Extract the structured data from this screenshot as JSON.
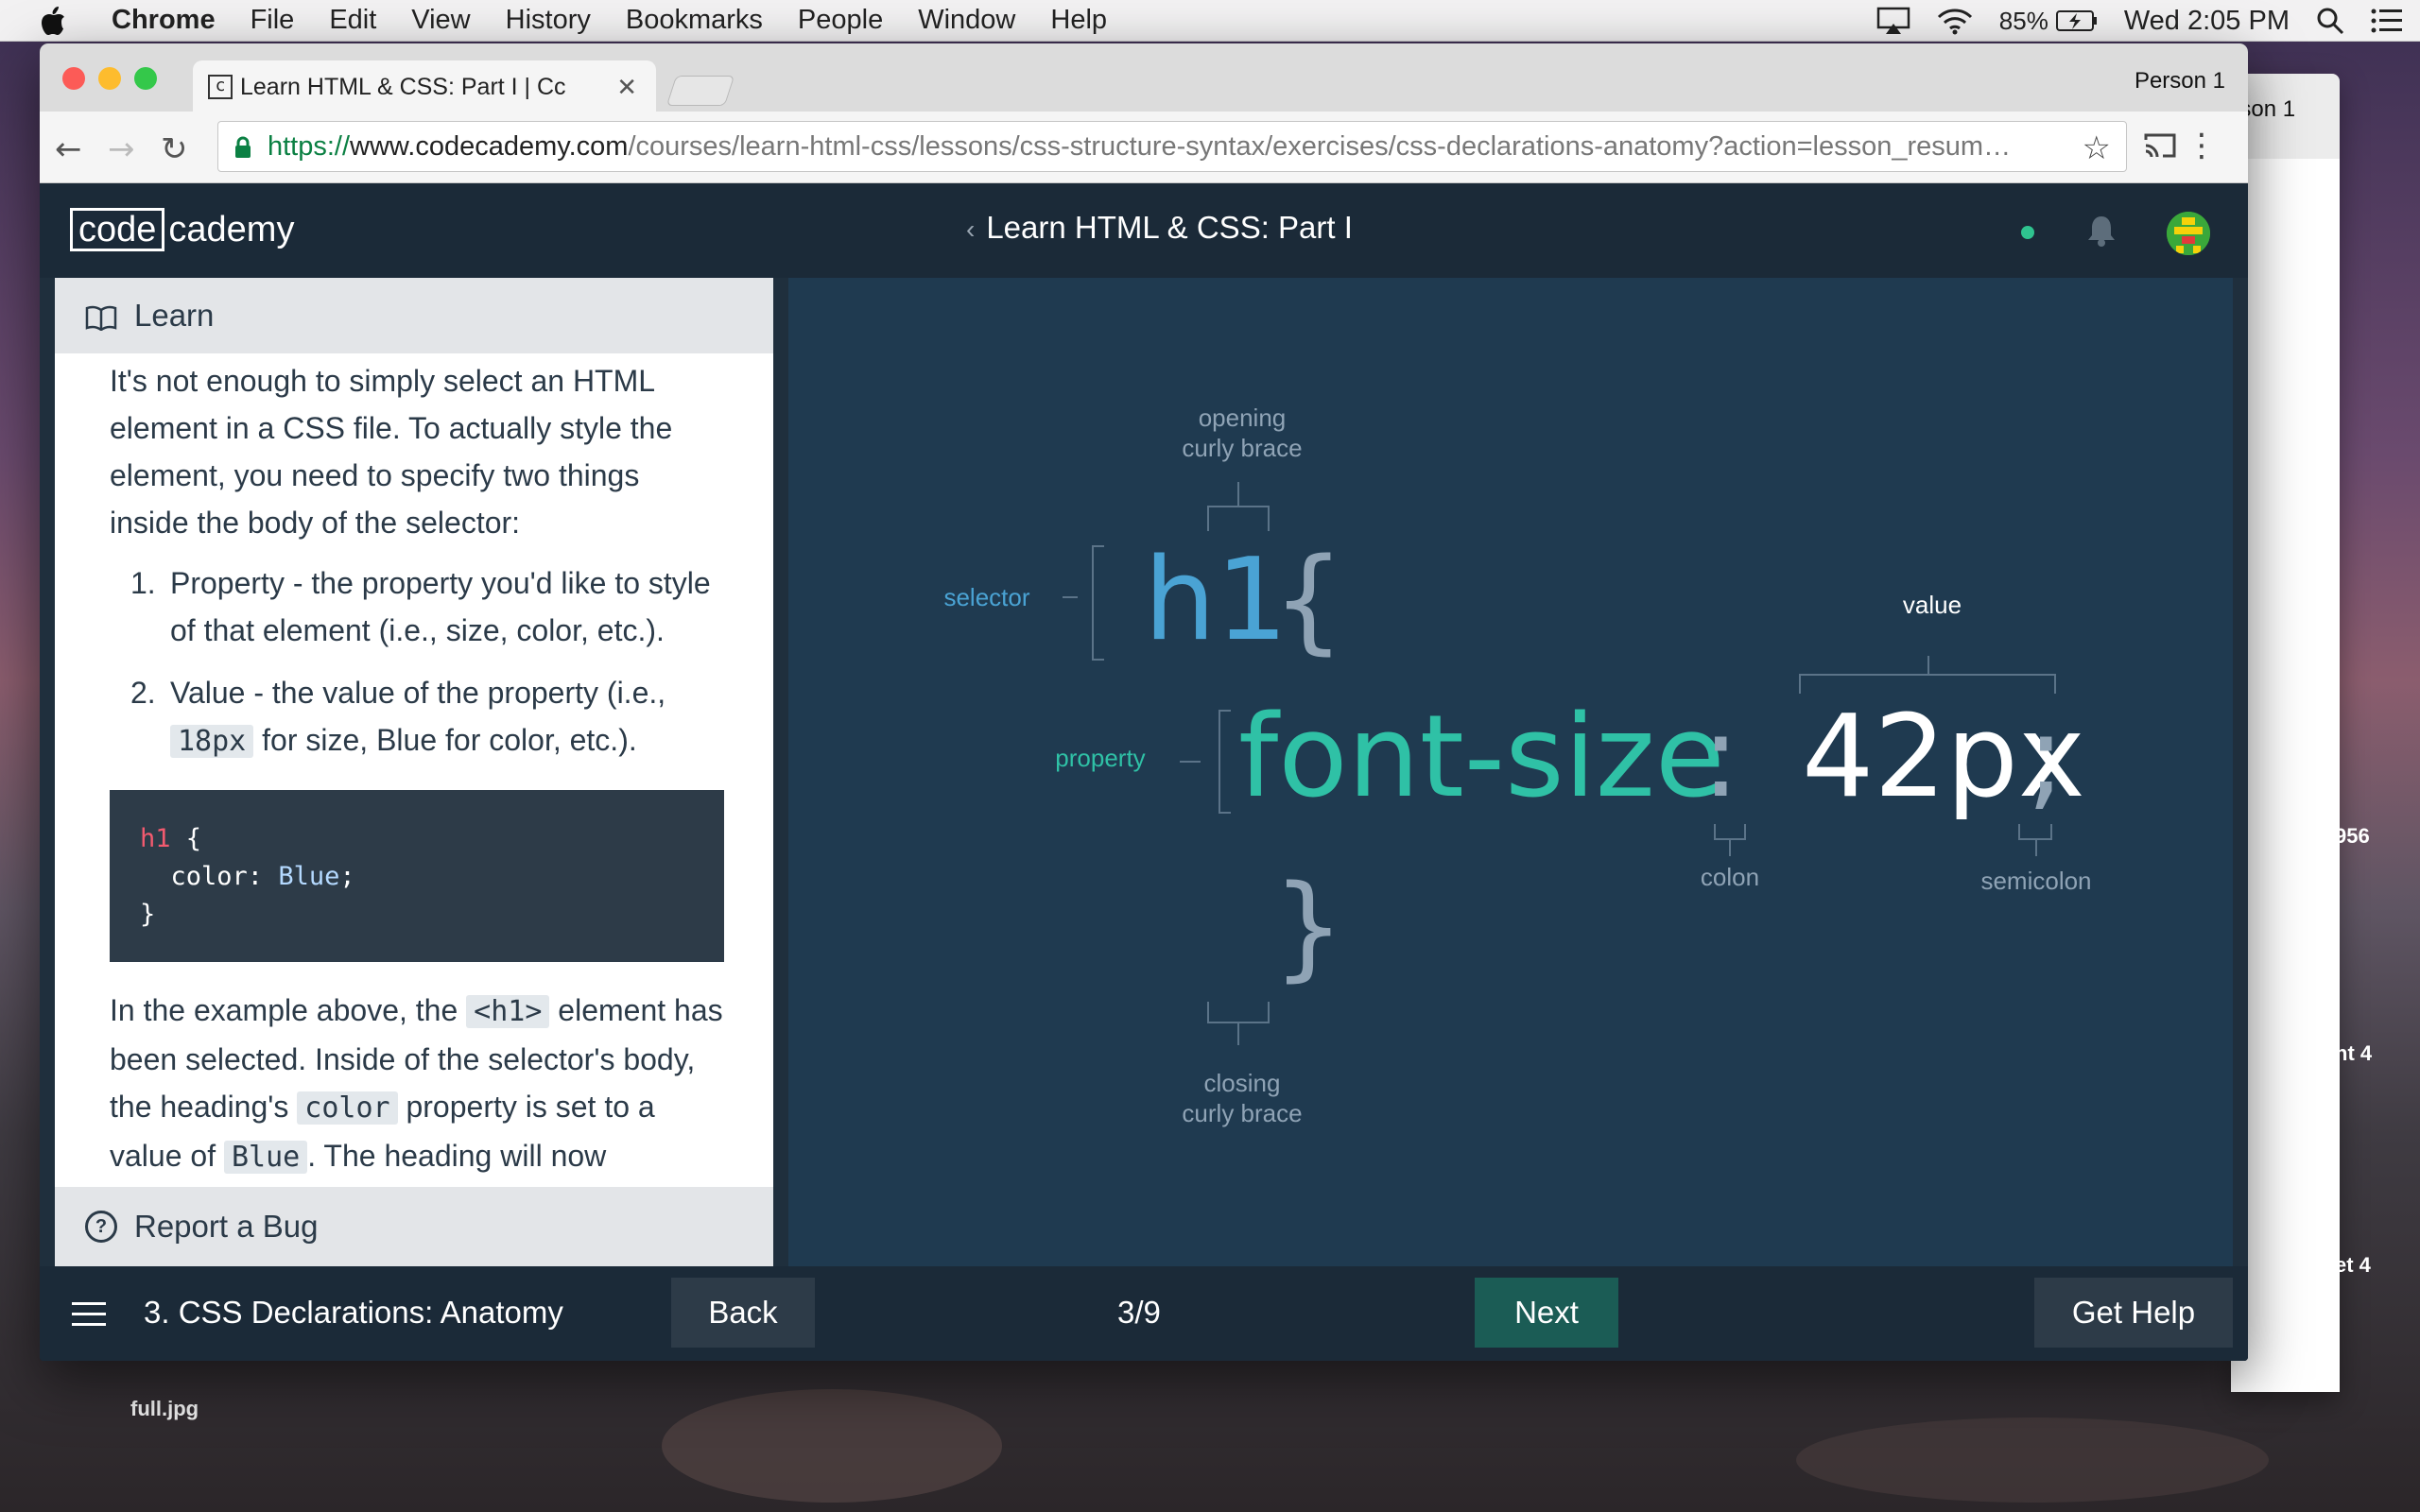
{
  "menubar": {
    "app": "Chrome",
    "items": [
      "File",
      "Edit",
      "View",
      "History",
      "Bookmarks",
      "People",
      "Window",
      "Help"
    ],
    "battery": "85%",
    "clock": "Wed 2:05 PM"
  },
  "background": {
    "window_person": "erson 1",
    "side_labels": [
      "956",
      "nt 4",
      "et 4"
    ],
    "desktop_file": "full.jpg"
  },
  "browser": {
    "tab_title": "Learn HTML & CSS: Part I | Cc",
    "person": "Person 1",
    "url_scheme": "https://",
    "url_host": "www.codecademy.com",
    "url_path": "/courses/learn-html-css/lessons/css-structure-syntax/exercises/css-declarations-anatomy?action=lesson_resum…"
  },
  "header": {
    "logo_boxed": "code",
    "logo_rest": "cademy",
    "course_title": "Learn HTML & CSS: Part I",
    "status_color": "#2fc38f"
  },
  "learn": {
    "heading": "Learn",
    "intro": "It's not enough to simply select an HTML element in a CSS file. To actually style the element, you need to specify two things inside the body of the selector:",
    "items": [
      {
        "num": "1.",
        "text": "Property - the property you'd like to style of that element (i.e., size, color, etc.)."
      },
      {
        "num": "2.",
        "pre": "Value - the value of the property (i.e.,",
        "code": "18px",
        "post": "for size, Blue for color, etc.)."
      }
    ],
    "code": {
      "line1_sel": "h1",
      "line1_rest": " {",
      "line2_prop": "  color: ",
      "line2_val": "Blue",
      "line2_end": ";",
      "line3": "}"
    },
    "para2": {
      "t1": "In the example above, the ",
      "c1": "<h1>",
      "t2": " element has been selected. Inside of the selector's body, the heading's ",
      "c2": "color",
      "t3": " property is set to a value of ",
      "c3": "Blue",
      "t4": ". The heading will now"
    },
    "report": "Report a Bug"
  },
  "diagram": {
    "labels": {
      "opening": [
        "opening",
        "curly brace"
      ],
      "selector": "selector",
      "value": "value",
      "property": "property",
      "colon": "colon",
      "semicolon": "semicolon",
      "closing": [
        "closing",
        "curly brace"
      ]
    },
    "code": {
      "selector": "h1",
      "open_brace": "{",
      "property": "font-size",
      "colon": ":",
      "value": "42px",
      "semicolon": ";",
      "close_brace": "}"
    },
    "colors": {
      "selector": "#4aa3d4",
      "property": "#2fc1a6",
      "value": "#ffffff",
      "punct": "#8fa3b5"
    }
  },
  "footer": {
    "lesson": "3. CSS Declarations: Anatomy",
    "back": "Back",
    "progress": "3/9",
    "next": "Next",
    "help": "Get Help"
  }
}
